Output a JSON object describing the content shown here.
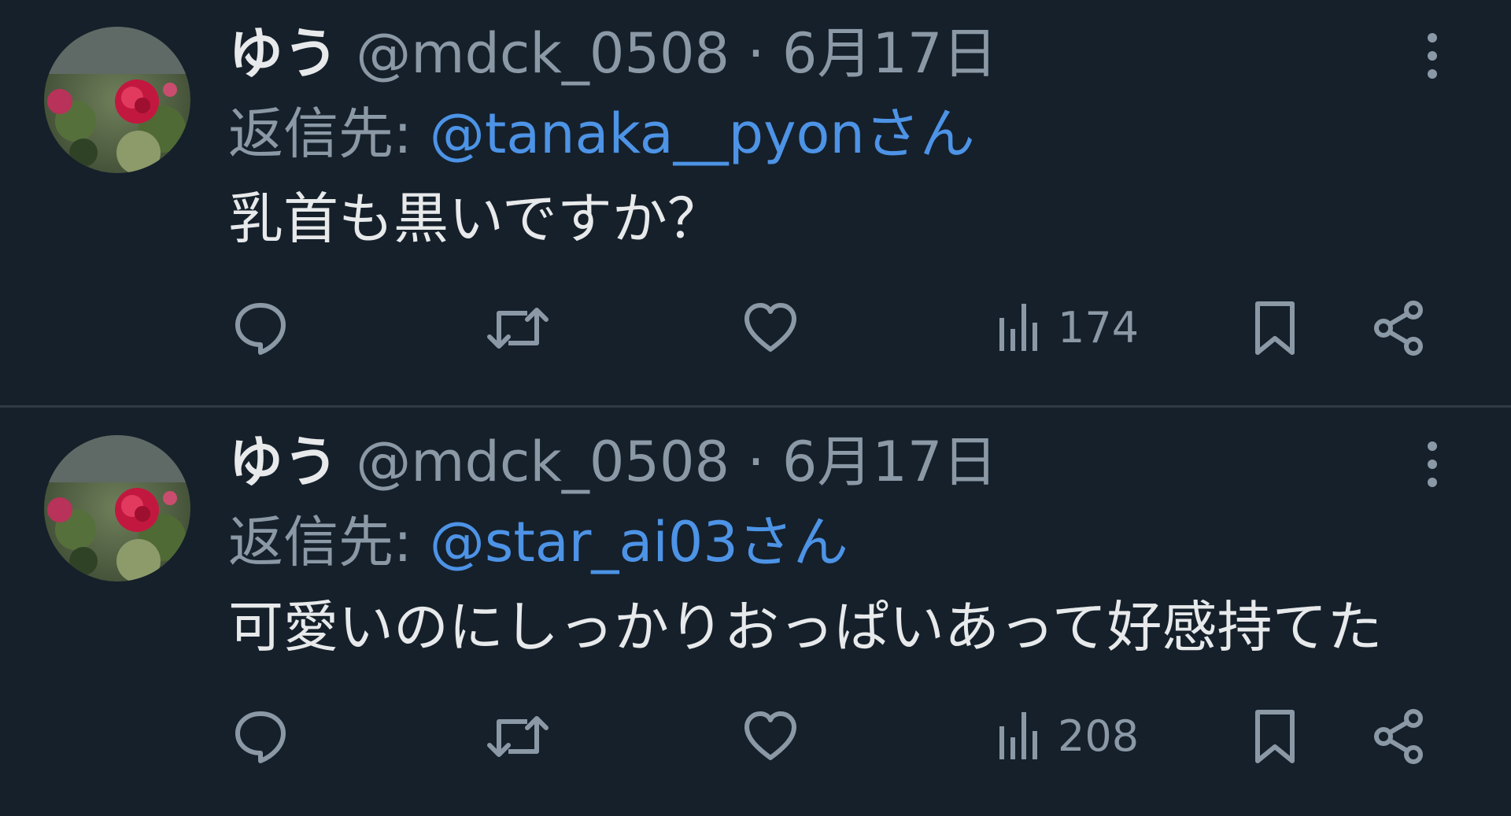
{
  "colors": {
    "background": "#15202b",
    "text_primary": "#e7e9ea",
    "text_secondary": "#8b98a5",
    "link": "#4d93e6",
    "divider": "#2f3a45"
  },
  "tweets": [
    {
      "author_name": "ゆう",
      "author_handle": "@mdck_0508",
      "separator": "·",
      "date": "6月17日",
      "reply_prefix": "返信先: ",
      "reply_to": "@tanaka__pyonさん",
      "text": "乳首も黒いですか？",
      "views": "174",
      "icons": [
        "reply-icon",
        "retweet-icon",
        "like-icon",
        "views-icon",
        "bookmark-icon",
        "share-icon",
        "more-icon"
      ]
    },
    {
      "author_name": "ゆう",
      "author_handle": "@mdck_0508",
      "separator": "·",
      "date": "6月17日",
      "reply_prefix": "返信先: ",
      "reply_to": "@star_ai03さん",
      "text": "可愛いのにしっかりおっぱいあって好感持てた",
      "views": "208",
      "icons": [
        "reply-icon",
        "retweet-icon",
        "like-icon",
        "views-icon",
        "bookmark-icon",
        "share-icon",
        "more-icon"
      ]
    }
  ]
}
